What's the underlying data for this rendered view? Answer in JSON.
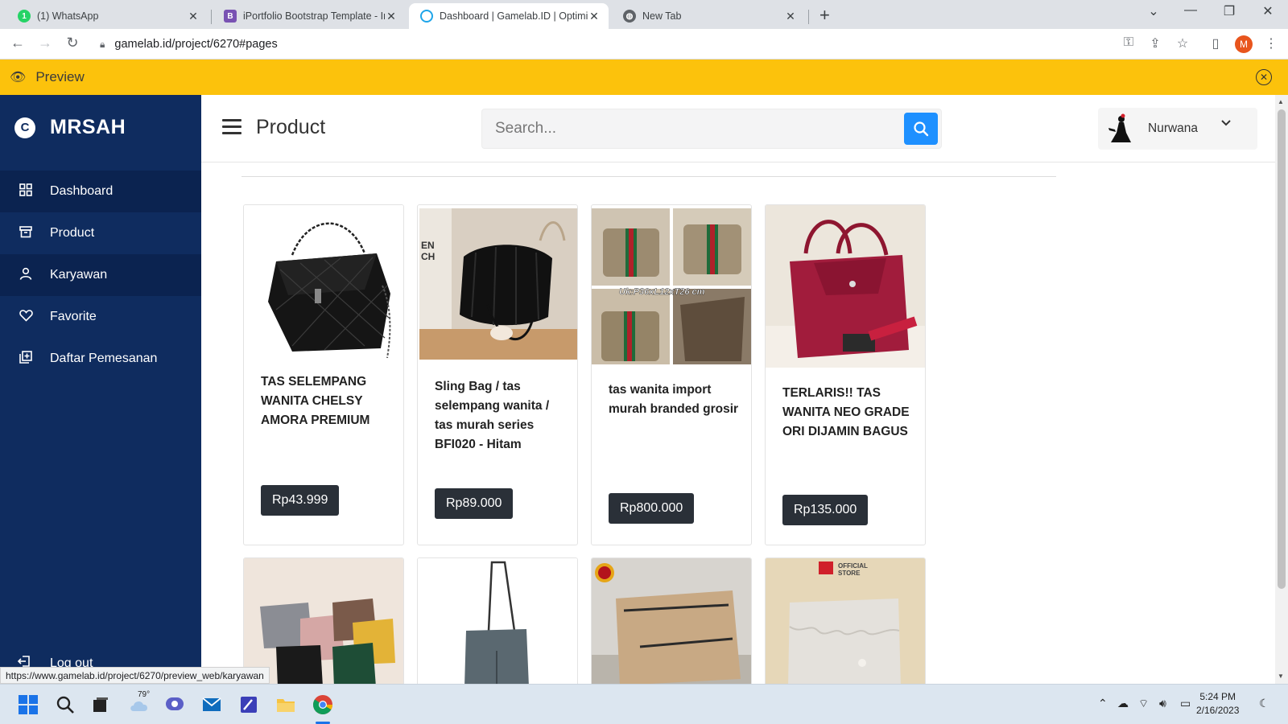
{
  "browser": {
    "tabs": [
      {
        "title": "(1) WhatsApp",
        "active": false
      },
      {
        "title": "iPortfolio Bootstrap Template - In",
        "active": false
      },
      {
        "title": "Dashboard | Gamelab.ID | Optimi",
        "active": true
      },
      {
        "title": "New Tab",
        "active": false
      }
    ],
    "url": "gamelab.id/project/6270#pages",
    "profile_initial": "M"
  },
  "preview": {
    "label": "Preview"
  },
  "sidebar": {
    "brand": "MRSAH",
    "items": [
      {
        "label": "Dashboard",
        "icon": "grid-icon"
      },
      {
        "label": "Product",
        "icon": "archive-icon"
      },
      {
        "label": "Karyawan",
        "icon": "user-icon"
      },
      {
        "label": "Favorite",
        "icon": "heart-icon"
      },
      {
        "label": "Daftar Pemesanan",
        "icon": "add-list-icon"
      }
    ],
    "logout": "Log out"
  },
  "header": {
    "title": "Product",
    "search_placeholder": "Search...",
    "user_name": "Nurwana"
  },
  "products": [
    {
      "name": "TAS SELEMPANG WANITA CHELSY AMORA PREMIUM",
      "price": "Rp43.999"
    },
    {
      "name": "Sling Bag / tas selempang wanita / tas murah series BFI020 - Hitam",
      "price": "Rp89.000"
    },
    {
      "name": "tas wanita import murah branded grosir",
      "price": "Rp800.000",
      "image_caption": "Uk:P36xL12xT26 cm"
    },
    {
      "name": "TERLARIS!! TAS WANITA NEO GRADE ORI DIJAMIN BAGUS",
      "price": "Rp135.000"
    }
  ],
  "products_row2": [
    {
      "badge": ""
    },
    {
      "badge": ""
    },
    {
      "badge": "BEST SELLER"
    },
    {
      "badge": "OFFICIAL STORE"
    }
  ],
  "status_url": "https://www.gamelab.id/project/6270/preview_web/karyawan",
  "taskbar": {
    "weather": "79°",
    "time": "5:24 PM",
    "date": "2/16/2023"
  },
  "colors": {
    "sidebar": "#0f2c5f",
    "preview_bar": "#fcc20c",
    "search_button": "#1e90ff",
    "price_badge": "#2a3038"
  }
}
